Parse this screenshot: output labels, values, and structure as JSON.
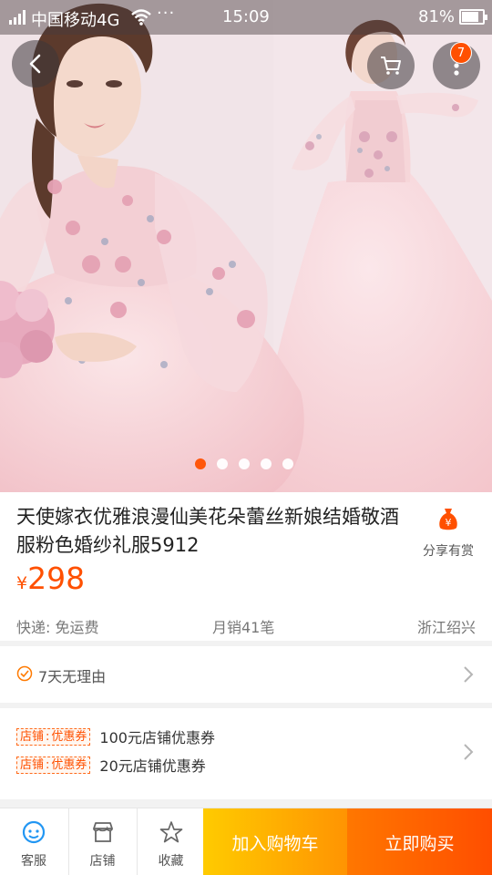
{
  "status_bar": {
    "carrier": "中国移动4G",
    "overflow": "···",
    "time": "15:09",
    "battery": "81%",
    "battery_level": 0.81
  },
  "nav": {
    "back_icon": "chevron-left-icon",
    "cart_icon": "cart-icon",
    "more_icon": "more-vertical-icon",
    "cart_badge": "7"
  },
  "gallery": {
    "image_count": 5,
    "active_index": 0
  },
  "product": {
    "title": "天使嫁衣优雅浪漫仙美花朵蕾丝新娘结婚敬酒服粉色婚纱礼服5912",
    "currency": "¥",
    "price": "298",
    "share_label": "分享有赏",
    "shipping": "快递: 免运费",
    "monthly_sales": "月销41笔",
    "location": "浙江绍兴"
  },
  "service": {
    "label": "7天无理由"
  },
  "coupons": [
    {
      "tag_left": "店铺",
      "tag_right": "优惠券",
      "text": "100元店铺优惠券"
    },
    {
      "tag_left": "店铺",
      "tag_right": "优惠券",
      "text": "20元店铺优惠券"
    }
  ],
  "bottom_bar": {
    "service_label": "客服",
    "shop_label": "店铺",
    "favorite_label": "收藏",
    "add_to_cart": "加入购物车",
    "buy_now": "立即购买"
  },
  "colors": {
    "accent": "#ff5000",
    "cart_button": "#ffa000",
    "buy_button": "#ff5a00"
  }
}
